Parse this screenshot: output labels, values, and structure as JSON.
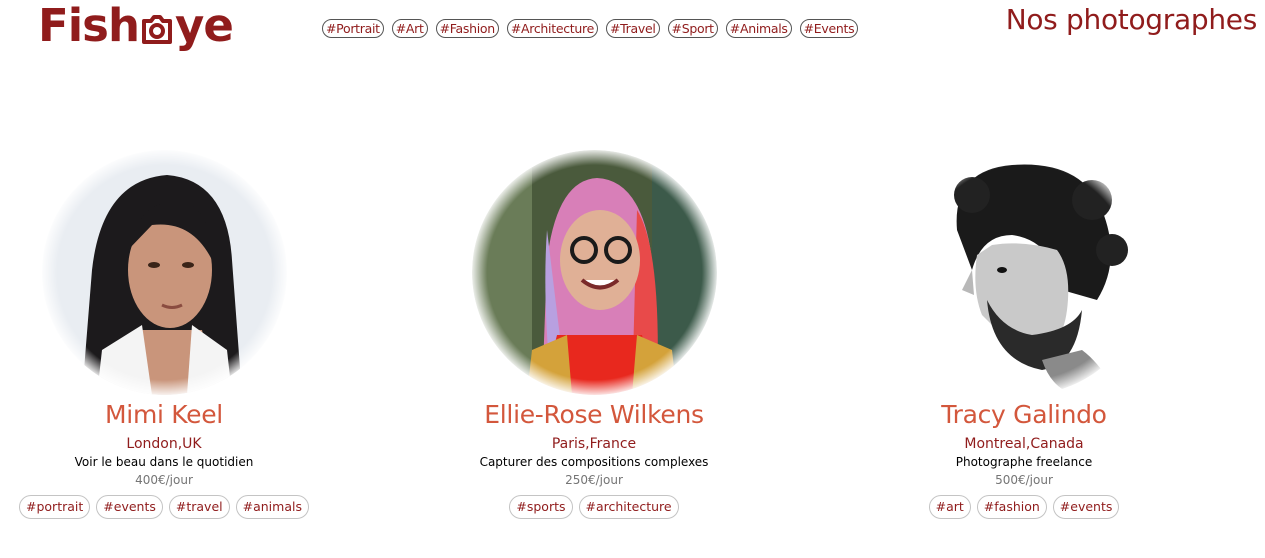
{
  "brand": {
    "name_left": "Fish",
    "name_right": "ye",
    "accent": "#901c1c",
    "name_color": "#d3573c"
  },
  "nav": {
    "tags": [
      "#Portrait",
      "#Art",
      "#Fashion",
      "#Architecture",
      "#Travel",
      "#Sport",
      "#Animals",
      "#Events"
    ]
  },
  "page_title": "Nos photographes",
  "photographers": [
    {
      "name": "Mimi Keel",
      "location": "London,UK",
      "tagline": "Voir le beau dans le quotidien",
      "price": "400€/jour",
      "tags": [
        "#portrait",
        "#events",
        "#travel",
        "#animals"
      ],
      "portrait_icon": "portrait-photo"
    },
    {
      "name": "Ellie-Rose Wilkens",
      "location": "Paris,France",
      "tagline": "Capturer des compositions complexes",
      "price": "250€/jour",
      "tags": [
        "#sports",
        "#architecture"
      ],
      "portrait_icon": "portrait-photo"
    },
    {
      "name": "Tracy Galindo",
      "location": "Montreal,Canada",
      "tagline": "Photographe freelance",
      "price": "500€/jour",
      "tags": [
        "#art",
        "#fashion",
        "#events"
      ],
      "portrait_icon": "portrait-photo"
    }
  ]
}
